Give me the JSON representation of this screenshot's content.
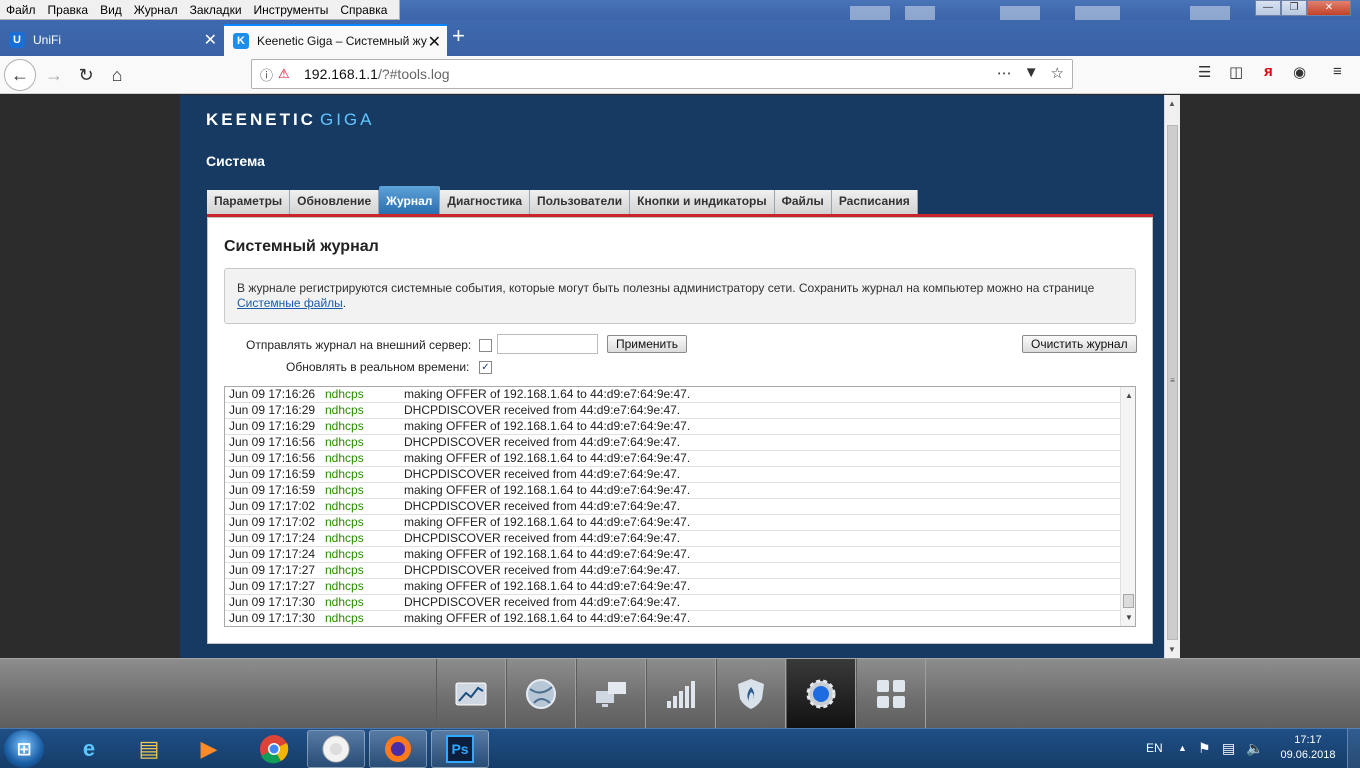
{
  "menubar": {
    "items": [
      "Файл",
      "Правка",
      "Вид",
      "Журнал",
      "Закладки",
      "Инструменты",
      "Справка"
    ]
  },
  "tabs": [
    {
      "title": "UniFi",
      "icon": "unifi-icon",
      "active": false
    },
    {
      "title": "Keenetic Giga – Системный жу",
      "icon": "keenetic-icon",
      "active": true
    }
  ],
  "address": {
    "host": "192.168.1.1",
    "path": "/?#tools.log"
  },
  "site": {
    "logo_main": "KEENETIC",
    "logo_sub": "GIGA",
    "section_title": "Система",
    "subtabs": [
      "Параметры",
      "Обновление",
      "Журнал",
      "Диагностика",
      "Пользователи",
      "Кнопки и индикаторы",
      "Файлы",
      "Расписания"
    ],
    "active_subtab": "Журнал",
    "panel_title": "Системный журнал",
    "notice_text": "В журнале регистрируются системные события, которые могут быть полезны администратору сети. Сохранить журнал на компьютер можно на странице",
    "notice_link": "Системные файлы",
    "notice_end": ".",
    "remote_label": "Отправлять журнал на внешний сервер:",
    "remote_checked": false,
    "remote_value": "",
    "apply_button": "Применить",
    "realtime_label": "Обновлять в реальном времени:",
    "realtime_checked": true,
    "clear_button": "Очистить журнал"
  },
  "log": [
    {
      "time": "Jun 09 17:16:26",
      "source": "ndhcps",
      "message": "making OFFER of 192.168.1.64 to 44:d9:e7:64:9e:47."
    },
    {
      "time": "Jun 09 17:16:29",
      "source": "ndhcps",
      "message": "DHCPDISCOVER received  from 44:d9:e7:64:9e:47."
    },
    {
      "time": "Jun 09 17:16:29",
      "source": "ndhcps",
      "message": "making OFFER of 192.168.1.64 to 44:d9:e7:64:9e:47."
    },
    {
      "time": "Jun 09 17:16:56",
      "source": "ndhcps",
      "message": "DHCPDISCOVER received  from 44:d9:e7:64:9e:47."
    },
    {
      "time": "Jun 09 17:16:56",
      "source": "ndhcps",
      "message": "making OFFER of 192.168.1.64 to 44:d9:e7:64:9e:47."
    },
    {
      "time": "Jun 09 17:16:59",
      "source": "ndhcps",
      "message": "DHCPDISCOVER received  from 44:d9:e7:64:9e:47."
    },
    {
      "time": "Jun 09 17:16:59",
      "source": "ndhcps",
      "message": "making OFFER of 192.168.1.64 to 44:d9:e7:64:9e:47."
    },
    {
      "time": "Jun 09 17:17:02",
      "source": "ndhcps",
      "message": "DHCPDISCOVER received  from 44:d9:e7:64:9e:47."
    },
    {
      "time": "Jun 09 17:17:02",
      "source": "ndhcps",
      "message": "making OFFER of 192.168.1.64 to 44:d9:e7:64:9e:47."
    },
    {
      "time": "Jun 09 17:17:24",
      "source": "ndhcps",
      "message": "DHCPDISCOVER received  from 44:d9:e7:64:9e:47."
    },
    {
      "time": "Jun 09 17:17:24",
      "source": "ndhcps",
      "message": "making OFFER of 192.168.1.64 to 44:d9:e7:64:9e:47."
    },
    {
      "time": "Jun 09 17:17:27",
      "source": "ndhcps",
      "message": "DHCPDISCOVER received  from 44:d9:e7:64:9e:47."
    },
    {
      "time": "Jun 09 17:17:27",
      "source": "ndhcps",
      "message": "making OFFER of 192.168.1.64 to 44:d9:e7:64:9e:47."
    },
    {
      "time": "Jun 09 17:17:30",
      "source": "ndhcps",
      "message": "DHCPDISCOVER received  from 44:d9:e7:64:9e:47."
    },
    {
      "time": "Jun 09 17:17:30",
      "source": "ndhcps",
      "message": "making OFFER of 192.168.1.64 to 44:d9:e7:64:9e:47."
    }
  ],
  "dock": {
    "items": [
      "monitor-icon",
      "internet-globe-icon",
      "home-network-icon",
      "wifi-signal-icon",
      "security-shield-icon",
      "system-gear-icon",
      "apps-grid-icon"
    ],
    "active": "system-gear-icon"
  },
  "taskbar": {
    "apps": [
      "internet-explorer-icon",
      "file-explorer-icon",
      "media-player-icon",
      "chrome-icon",
      "unifi-app-icon",
      "firefox-icon",
      "photoshop-icon"
    ],
    "photoshop_label": "Ps",
    "language": "EN",
    "time": "17:17",
    "date": "09.06.2018"
  },
  "colors": {
    "site_bg": "#163a62",
    "accent_red": "#c8262b",
    "active_tab": "#2a6fb0",
    "log_source": "#2a8a00",
    "logo_sub": "#5ec6ff"
  }
}
